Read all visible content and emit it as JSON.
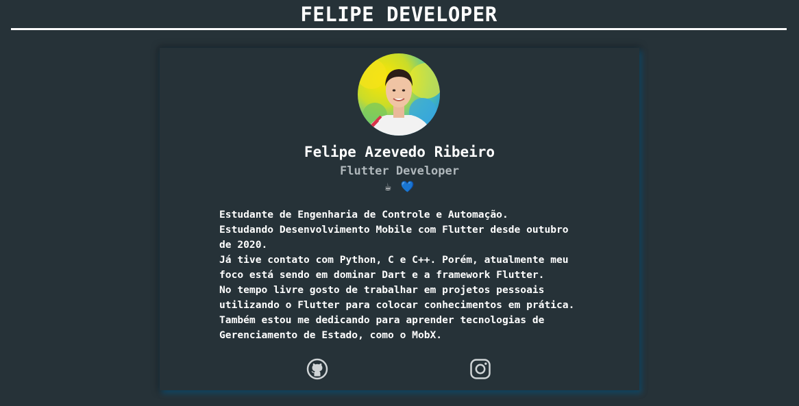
{
  "header": {
    "title": "FELIPE DEVELOPER"
  },
  "profile": {
    "name": "Felipe Azevedo Ribeiro",
    "role": "Flutter Developer",
    "emojis": [
      "☕",
      "💙"
    ]
  },
  "bio": {
    "lines": [
      "Estudante de Engenharia de Controle e Automação.",
      "Estudando Desenvolvimento Mobile com Flutter desde outubro",
      "de 2020.",
      "Já tive contato com Python, C e C++. Porém, atualmente meu",
      "foco está sendo em dominar Dart e a framework Flutter.",
      "No tempo livre gosto de trabalhar em projetos pessoais",
      "utilizando o Flutter para colocar conhecimentos em prática.",
      "Também estou me dedicando para aprender tecnologias de",
      "Gerenciamento de Estado, como o MobX."
    ]
  },
  "social": {
    "icons": [
      "github-icon",
      "instagram-icon"
    ]
  },
  "colors": {
    "background": "#263238",
    "text": "#ffffff",
    "muted": "#b0b8bc",
    "accent": "#1e88e5"
  }
}
